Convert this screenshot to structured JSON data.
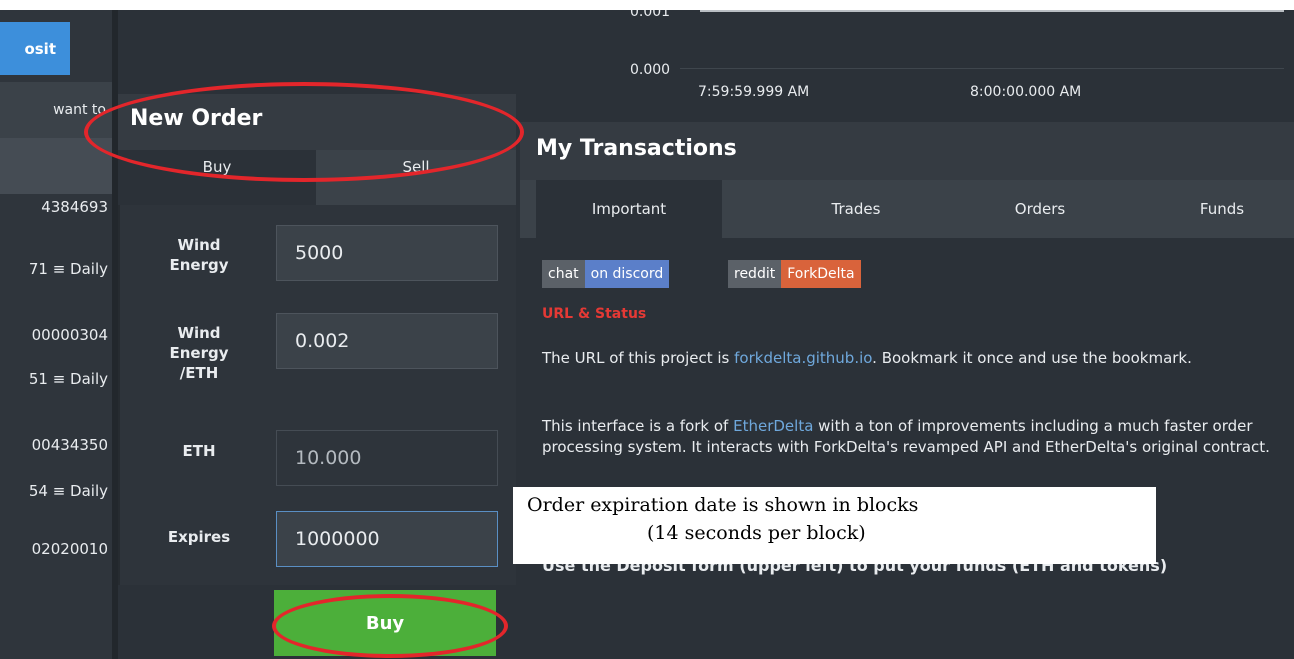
{
  "left": {
    "deposit_label": "osit",
    "header_text": "want to",
    "rows": [
      "4384693",
      "71 ≡ Daily",
      "00000304",
      "51 ≡ Daily",
      "00434350",
      "54 ≡ Daily",
      "02020010"
    ]
  },
  "order": {
    "title": "New Order",
    "tabs": {
      "buy": "Buy",
      "sell": "Sell"
    },
    "fields": [
      {
        "label_lines": [
          "Wind",
          "Energy"
        ],
        "value": "5000"
      },
      {
        "label_lines": [
          "Wind",
          "Energy",
          "/ETH"
        ],
        "value": "0.002"
      },
      {
        "label_lines": [
          "ETH"
        ],
        "value": "10.000"
      },
      {
        "label_lines": [
          "Expires"
        ],
        "value": "1000000"
      }
    ],
    "buy_button": "Buy"
  },
  "chart": {
    "y_top": "0.001",
    "y_zero": "0.000",
    "x_labels": [
      "7:59:59.999 AM",
      "8:00:00.000 AM"
    ]
  },
  "transactions": {
    "title": "My Transactions",
    "tabs": [
      "Important",
      "Trades",
      "Orders",
      "Funds"
    ],
    "badges": {
      "chat_key": "chat",
      "chat_val": "on discord",
      "reddit_key": "reddit",
      "reddit_val": "ForkDelta"
    },
    "url_heading": "URL & Status",
    "para1_a": "The URL of this project is ",
    "para1_link": "forkdelta.github.io",
    "para1_b": ". Bookmark it once and use the bookmark.",
    "para2_a": "This interface is a fork of ",
    "para2_link": "EtherDelta",
    "para2_b": " with a ton of improvements including a much faster order processing system. It interacts with ForkDelta's revamped API and EtherDelta's original contract.",
    "deposit_tip": "Use the Deposit form (upper left) to put your funds (ETH and tokens)"
  },
  "tooltip": {
    "line1": "Order expiration date is shown in blocks",
    "line2": "(14 seconds per block)"
  },
  "colors": {
    "annotation": "#e3262b",
    "buy_green": "#4caf3a",
    "deposit_blue": "#3d8fdb"
  }
}
